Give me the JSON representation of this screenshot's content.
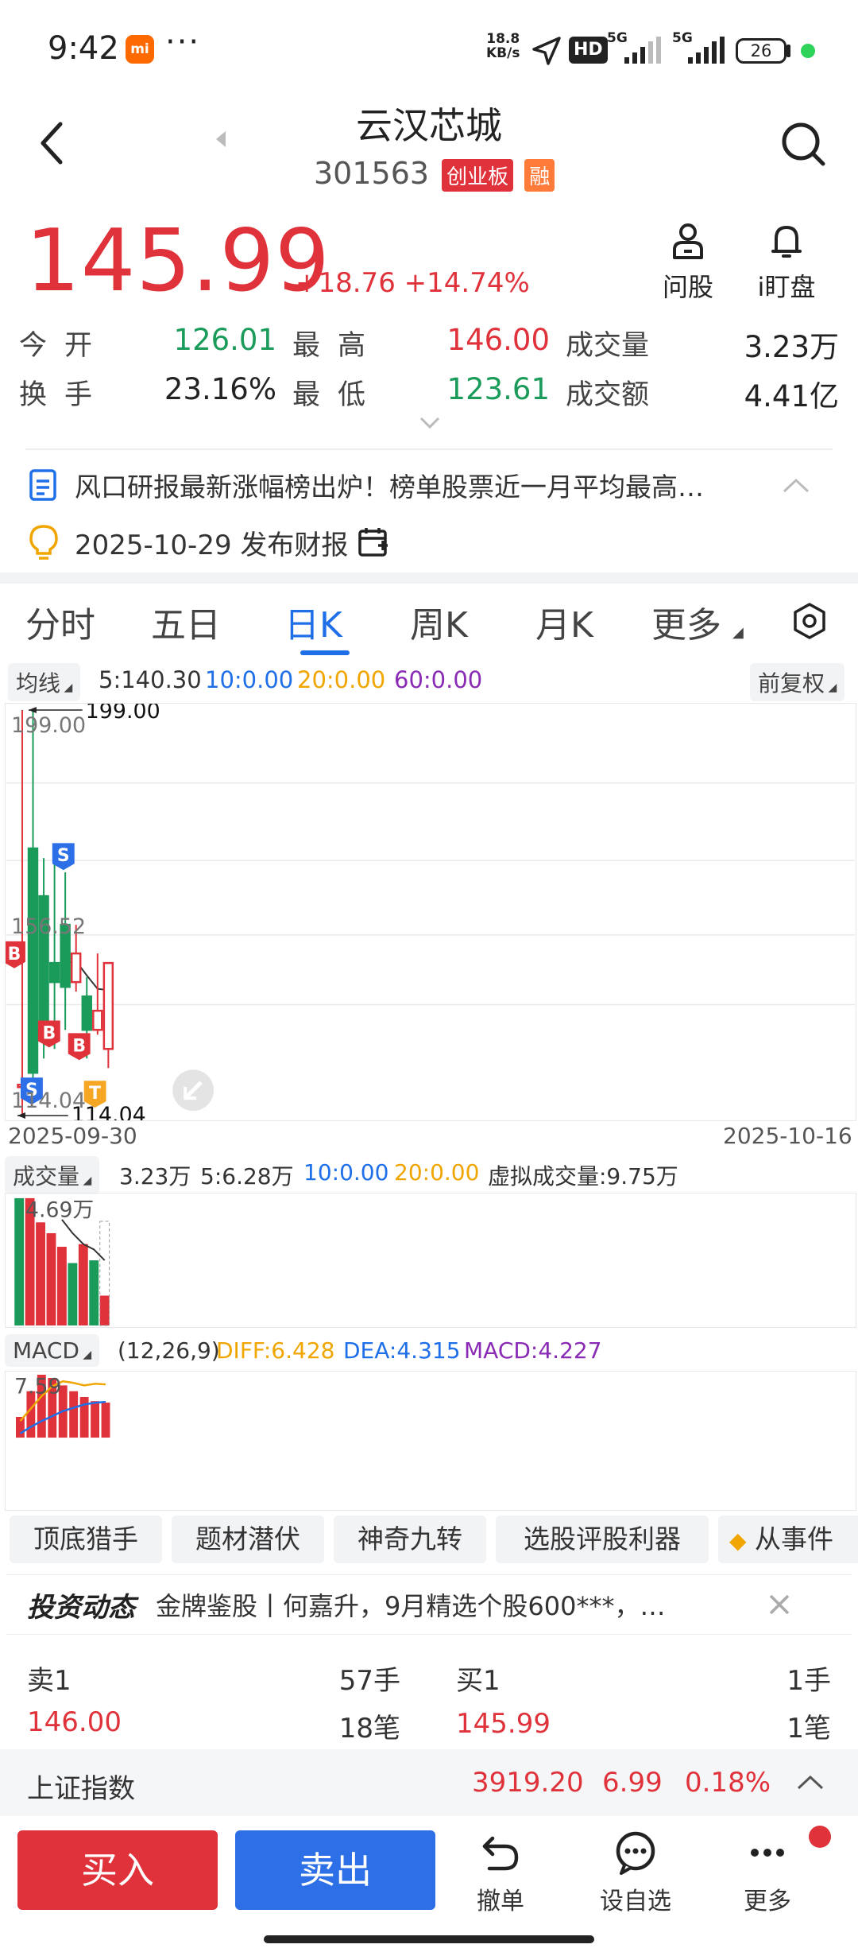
{
  "status": {
    "time": "9:42",
    "dots": "···",
    "speed_value": "18.8",
    "speed_unit": "KB/s",
    "hd": "HD",
    "net1": "5G",
    "net2": "5G",
    "battery": "26"
  },
  "header": {
    "title": "云汉芯城",
    "code": "301563",
    "board_tag": "创业板",
    "margin_tag": "融"
  },
  "quote": {
    "price": "145.99",
    "change": "+18.76",
    "change_pct": "+14.74%",
    "ask_label": "问股",
    "watch_label": "i盯盘",
    "open_label": "今开",
    "open_value": "126.01",
    "high_label": "最高",
    "high_value": "146.00",
    "volume_label": "成交量",
    "volume_value": "3.23万",
    "turnover_label": "换手",
    "turnover_value": "23.16%",
    "low_label": "最低",
    "low_value": "123.61",
    "amount_label": "成交额",
    "amount_value": "4.41亿"
  },
  "news": {
    "headline": "风口研报最新涨幅榜出炉！榜单股票近一月平均最高…",
    "report": "2025-10-29 发布财报"
  },
  "tabs": [
    "分时",
    "五日",
    "日K",
    "周K",
    "月K",
    "更多"
  ],
  "active_tab": 2,
  "ma": {
    "label": "均线",
    "ma5": "5:140.30",
    "ma10": "10:0.00",
    "ma20": "20:0.00",
    "ma60": "60:0.00",
    "adjust": "前复权",
    "colors": {
      "ma5": "#333333",
      "ma10": "#1e6fe8",
      "ma20": "#f0a500",
      "ma60": "#8a2bb5"
    }
  },
  "chart_data": [
    {
      "type": "candlestick",
      "ylim": [
        114.04,
        199.0
      ],
      "y_ticks": [
        "199.00",
        "156.52",
        "114.04"
      ],
      "max_marker": "199.00",
      "min_marker": "114.04",
      "x_start": "2025-09-30",
      "x_end": "2025-10-16",
      "candles": [
        {
          "open": 120,
          "close": 120.5,
          "high": 199,
          "low": 114.04
        },
        {
          "open": 170,
          "close": 123,
          "high": 199,
          "low": 118
        },
        {
          "open": 160,
          "close": 133,
          "high": 168,
          "low": 126
        },
        {
          "open": 146,
          "close": 142,
          "high": 168,
          "low": 128
        },
        {
          "open": 154,
          "close": 141,
          "high": 165,
          "low": 132
        },
        {
          "open": 142,
          "close": 148,
          "high": 154,
          "low": 140
        },
        {
          "open": 139,
          "close": 132,
          "high": 143,
          "low": 126
        },
        {
          "open": 132,
          "close": 136,
          "high": 148,
          "low": 131
        },
        {
          "open": 128,
          "close": 146,
          "high": 146,
          "low": 124
        }
      ],
      "ma5_line": [
        null,
        null,
        null,
        null,
        146.0,
        146.4,
        143.4,
        140.6,
        140.3
      ],
      "signals": [
        {
          "i": 0,
          "label": "B",
          "kind": "buy"
        },
        {
          "i": 1,
          "label": "S",
          "kind": "sell"
        },
        {
          "i": 2,
          "label": "B",
          "kind": "buy"
        },
        {
          "i": 3,
          "label": "S",
          "kind": "sell"
        },
        {
          "i": 4,
          "label": "B",
          "kind": "buy"
        },
        {
          "i": 5,
          "label": "T",
          "kind": "t"
        }
      ]
    },
    {
      "type": "bar",
      "title": "成交量",
      "max_label": "4.69万",
      "ylim": [
        0,
        4.69
      ],
      "values": [
        4.69,
        4.69,
        3.8,
        3.4,
        2.9,
        2.3,
        3.0,
        2.4,
        1.1
      ],
      "up": [
        false,
        true,
        true,
        true,
        true,
        false,
        true,
        false,
        true
      ],
      "ma5_line": [
        null,
        null,
        null,
        null,
        3.9,
        3.4,
        3.0,
        2.8,
        2.4
      ],
      "legend": {
        "label": "成交量",
        "value": "3.23万",
        "ma5": "5:6.28万",
        "ma10": "10:0.00",
        "ma20": "20:0.00",
        "virtual": "虚拟成交量:9.75万"
      }
    },
    {
      "type": "bar",
      "title": "MACD",
      "max_label": "7.59",
      "ylim": [
        0,
        7.59
      ],
      "values": [
        2.5,
        5.6,
        7.59,
        7.2,
        6.3,
        5.6,
        4.9,
        4.4,
        4.227
      ],
      "diff_line": [
        2.0,
        3.5,
        5.0,
        6.2,
        6.8,
        6.6,
        6.3,
        6.5,
        6.428
      ],
      "dea_line": [
        0.5,
        1.3,
        2.0,
        2.6,
        3.2,
        3.6,
        4.0,
        4.2,
        4.315
      ],
      "legend": {
        "label": "MACD",
        "params": "(12,26,9)",
        "diff": "DIFF:6.428",
        "dea": "DEA:4.315",
        "macd": "MACD:4.227"
      }
    }
  ],
  "tools": [
    "顶底猎手",
    "题材潜伏",
    "神奇九转",
    "选股评股利器",
    "从事件"
  ],
  "invest": {
    "brand": "投资动态",
    "text": "金牌鉴股丨何嘉升，9月精选个股600***，…"
  },
  "orderbook": {
    "sell_label": "卖1",
    "sell_qty": "57手",
    "sell_price": "146.00",
    "sell_orders": "18笔",
    "buy_label": "买1",
    "buy_qty": "1手",
    "buy_price": "145.99",
    "buy_orders": "1笔"
  },
  "index": {
    "name": "上证指数",
    "value": "3919.20",
    "change": "6.99",
    "pct": "0.18%"
  },
  "bottom": {
    "buy": "买入",
    "sell": "卖出",
    "cancel": "撤单",
    "watchlist": "设自选",
    "more": "更多"
  }
}
